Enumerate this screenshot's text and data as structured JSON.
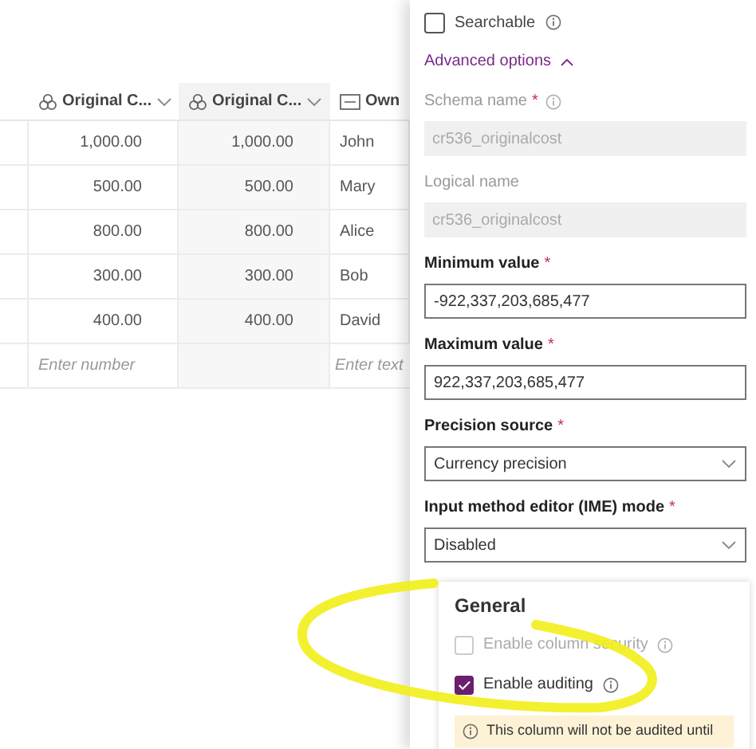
{
  "grid": {
    "columns": [
      {
        "label": "Original C...",
        "kind": "currency",
        "sorted": false
      },
      {
        "label": "Original C...",
        "kind": "currency",
        "sorted": true
      },
      {
        "label": "Own",
        "kind": "text",
        "sorted": false
      }
    ],
    "rows": [
      [
        "1,000.00",
        "1,000.00",
        "John"
      ],
      [
        "500.00",
        "500.00",
        "Mary"
      ],
      [
        "800.00",
        "800.00",
        "Alice"
      ],
      [
        "300.00",
        "300.00",
        "Bob"
      ],
      [
        "400.00",
        "400.00",
        "David"
      ]
    ],
    "new_row": {
      "placeholders": [
        "Enter number",
        "Enter text"
      ]
    }
  },
  "panel": {
    "searchable": {
      "label": "Searchable",
      "checked": false
    },
    "advanced_toggle": {
      "label": "Advanced options",
      "expanded": true
    },
    "fields": [
      {
        "label": "Schema name",
        "required_mark": "*",
        "info": true,
        "value": "cr536_originalcost",
        "disabled": true,
        "kind": "text"
      },
      {
        "label": "Logical name",
        "info": false,
        "value": "cr536_originalcost",
        "disabled": true,
        "kind": "text"
      },
      {
        "label": "Minimum value",
        "required_mark": "*",
        "info": false,
        "value": "-922,337,203,685,477",
        "disabled": false,
        "kind": "text"
      },
      {
        "label": "Maximum value",
        "required_mark": "*",
        "info": false,
        "value": "922,337,203,685,477",
        "disabled": false,
        "kind": "text"
      },
      {
        "label": "Precision source",
        "required_mark": "*",
        "info": false,
        "value": "Currency precision",
        "disabled": false,
        "kind": "select"
      },
      {
        "label": "Input method editor (IME) mode",
        "required_mark": "*",
        "info": false,
        "value": "Disabled",
        "disabled": false,
        "kind": "select"
      }
    ],
    "general": {
      "title": "General",
      "options": [
        {
          "label": "Enable column security",
          "checked": false,
          "disabled": true
        },
        {
          "label": "Enable auditing",
          "checked": true,
          "disabled": false
        }
      ],
      "notice": "This column will not be audited until"
    }
  }
}
